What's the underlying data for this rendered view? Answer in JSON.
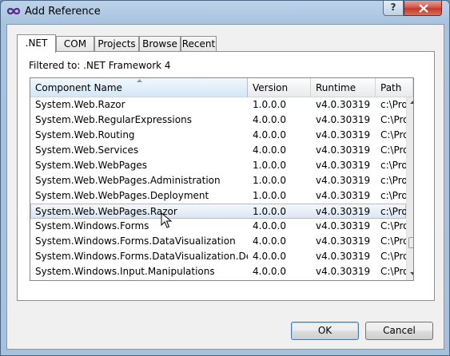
{
  "window": {
    "title": "Add Reference",
    "help_label": "?"
  },
  "tabs": [
    {
      "label": ".NET",
      "active": true
    },
    {
      "label": "COM",
      "active": false
    },
    {
      "label": "Projects",
      "active": false
    },
    {
      "label": "Browse",
      "active": false
    },
    {
      "label": "Recent",
      "active": false
    }
  ],
  "filter_text": "Filtered to: .NET Framework 4",
  "list": {
    "columns": [
      "Component Name",
      "Version",
      "Runtime",
      "Path"
    ],
    "sorted_column": "Component Name",
    "rows": [
      {
        "name": "System.Web.Razor",
        "version": "1.0.0.0",
        "runtime": "v4.0.30319",
        "path": "c:\\Prog"
      },
      {
        "name": "System.Web.RegularExpressions",
        "version": "4.0.0.0",
        "runtime": "v4.0.30319",
        "path": "C:\\Pro"
      },
      {
        "name": "System.Web.Routing",
        "version": "4.0.0.0",
        "runtime": "v4.0.30319",
        "path": "C:\\Pro"
      },
      {
        "name": "System.Web.Services",
        "version": "4.0.0.0",
        "runtime": "v4.0.30319",
        "path": "C:\\Pro"
      },
      {
        "name": "System.Web.WebPages",
        "version": "1.0.0.0",
        "runtime": "v4.0.30319",
        "path": "c:\\Prog"
      },
      {
        "name": "System.Web.WebPages.Administration",
        "version": "1.0.0.0",
        "runtime": "v4.0.30319",
        "path": "c:\\Prog"
      },
      {
        "name": "System.Web.WebPages.Deployment",
        "version": "1.0.0.0",
        "runtime": "v4.0.30319",
        "path": "c:\\Prog"
      },
      {
        "name": "System.Web.WebPages.Razor",
        "version": "1.0.0.0",
        "runtime": "v4.0.30319",
        "path": "c:\\Prog",
        "selected": true
      },
      {
        "name": "System.Windows.Forms",
        "version": "4.0.0.0",
        "runtime": "v4.0.30319",
        "path": "C:\\Pro"
      },
      {
        "name": "System.Windows.Forms.DataVisualization",
        "version": "4.0.0.0",
        "runtime": "v4.0.30319",
        "path": "C:\\Pro"
      },
      {
        "name": "System.Windows.Forms.DataVisualization.Design",
        "version": "4.0.0.0",
        "runtime": "v4.0.30319",
        "path": "C:\\Pro"
      },
      {
        "name": "System.Windows.Input.Manipulations",
        "version": "4.0.0.0",
        "runtime": "v4.0.30319",
        "path": "C:\\Pro"
      }
    ]
  },
  "buttons": {
    "ok_label": "OK",
    "cancel_label": "Cancel"
  },
  "icons": {
    "app": "infinity-icon",
    "close": "close-icon",
    "sort": "sort-up-arrow-icon",
    "cursor": "mouse-pointer-icon"
  },
  "colors": {
    "title_bar": "#a9c3de",
    "close_button": "#c13a2a",
    "selected_row": "#dbe7f3",
    "default_button_border": "#3c7fb1"
  }
}
